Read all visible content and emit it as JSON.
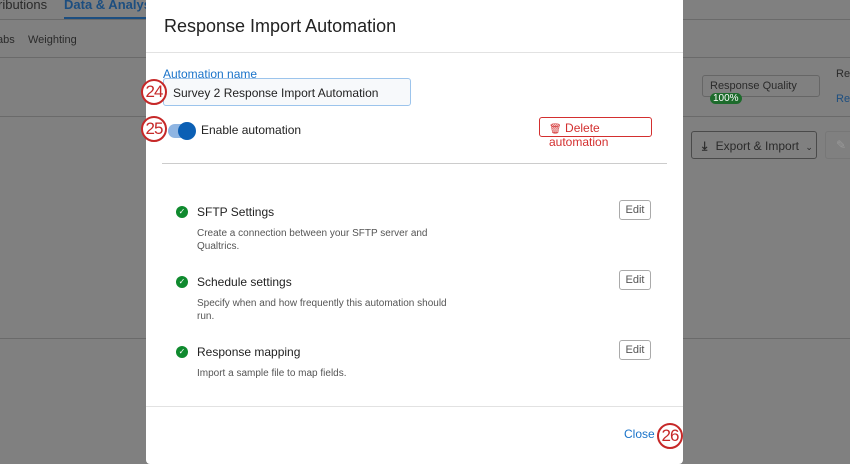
{
  "background": {
    "nav_tab_prev": "ributions",
    "nav_tab_active": "Data & Analysis",
    "subtab_prev": "abs",
    "subtab_weighting": "Weighting",
    "response_quality_label": "Response Quality",
    "response_quality_value": "100%",
    "right_cut_1": "Re",
    "right_link_cut": "Re",
    "export_import": "Export & Import"
  },
  "modal": {
    "title": "Response Import Automation",
    "name_label": "Automation name",
    "name_value": "Survey 2 Response Import Automation",
    "enable_label": "Enable automation",
    "enabled": true,
    "delete_label": "Delete automation",
    "steps": [
      {
        "title": "SFTP Settings",
        "desc": "Create a connection between your SFTP server and Qualtrics.",
        "edit": "Edit"
      },
      {
        "title": "Schedule settings",
        "desc": "Specify when and how frequently this automation should run.",
        "edit": "Edit"
      },
      {
        "title": "Response mapping",
        "desc": "Import a sample file to map fields.",
        "edit": "Edit"
      }
    ],
    "close_label": "Close"
  },
  "callouts": [
    "24",
    "25",
    "26"
  ]
}
